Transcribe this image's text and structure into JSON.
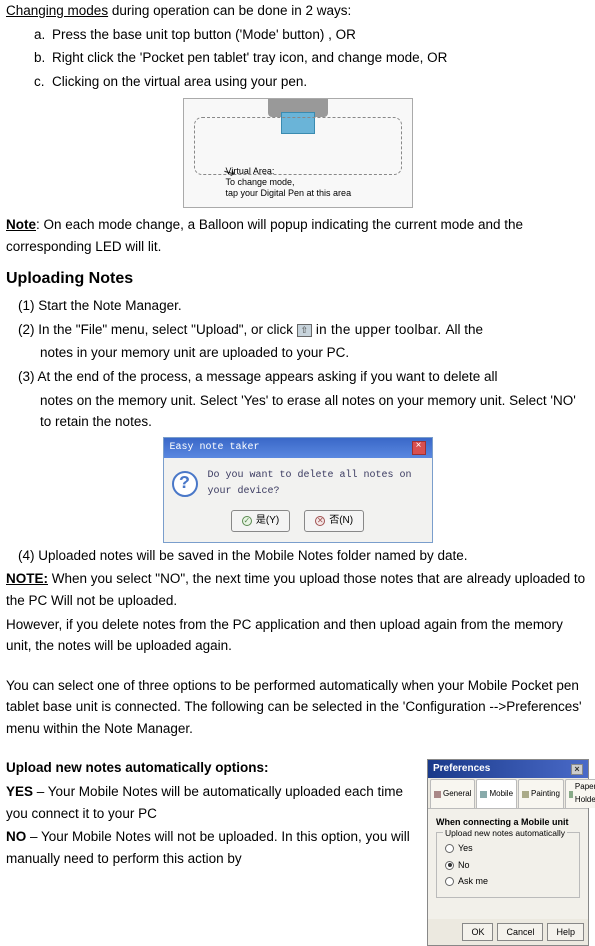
{
  "intro": {
    "changing_modes": "Changing modes",
    "rest": " during operation can be done in 2 ways:"
  },
  "list1": {
    "a": {
      "letter": "a.",
      "text": "Press the base unit top button ('Mode' button) , OR"
    },
    "b": {
      "letter": "b.",
      "text": "Right click the 'Pocket pen tablet' tray icon, and change mode, OR"
    },
    "c": {
      "letter": "c.",
      "text": "Clicking on the virtual area using your pen."
    }
  },
  "fig1": {
    "line1": "Virtual Area:",
    "line2": "To change mode,",
    "line3": "tap your Digital Pen at this area"
  },
  "note1": {
    "label": "Note",
    "text": ": On each mode change, a Balloon will popup indicating the current mode and the corresponding LED will lit."
  },
  "section_title": "Uploading Notes",
  "steps": {
    "s1": "(1) Start the Note Manager.",
    "s2a": "(2) In the \"File\" menu, select \"Upload\", or click ",
    "s2b": " in the upper toolbar. ",
    "s2c": "All the",
    "s2d": "notes in your memory unit are uploaded to your PC.",
    "s3a": "(3) At the end of the process, a message appears asking if you want to delete all",
    "s3b": "notes on the memory unit. Select 'Yes' to erase all notes on your memory unit. Select 'NO' to retain the notes."
  },
  "dialog": {
    "title": "Easy note taker",
    "msg": "Do you want to delete all notes on your device?",
    "yes": "是(Y)",
    "no": "否(N)"
  },
  "step4": " (4) Uploaded notes will be saved in the Mobile Notes folder named by date.",
  "note2": {
    "label": "NOTE:",
    "text": " When you select \"NO\", the next time you upload those notes that are already uploaded to the PC Will not be uploaded."
  },
  "however": "However, if you delete notes from the PC application and then upload again from the memory unit, the notes will be uploaded again.",
  "options_intro": "You can select one of three options to be performed automatically when your Mobile Pocket pen tablet base unit is connected. The following can be selected in the 'Configuration -->Preferences' menu within the Note Manager.",
  "options_heading": "Upload new notes automatically options:",
  "yes_opt": {
    "label": "YES",
    "text": " – Your Mobile Notes will be automatically uploaded each time you connect it to your PC"
  },
  "no_opt": {
    "label": "NO",
    "text": " – Your Mobile Notes will not be uploaded. In this option, you will manually need to perform this action by"
  },
  "prefs": {
    "title": "Preferences",
    "tabs": {
      "general": "General",
      "mobile": "Mobile",
      "painting": "Painting",
      "paper": "Paper Holder"
    },
    "section": "When connecting a Mobile unit",
    "group": "Upload new notes automatically",
    "r1": "Yes",
    "r2": "No",
    "r3": "Ask me",
    "ok": "OK",
    "cancel": "Cancel",
    "help": "Help"
  }
}
